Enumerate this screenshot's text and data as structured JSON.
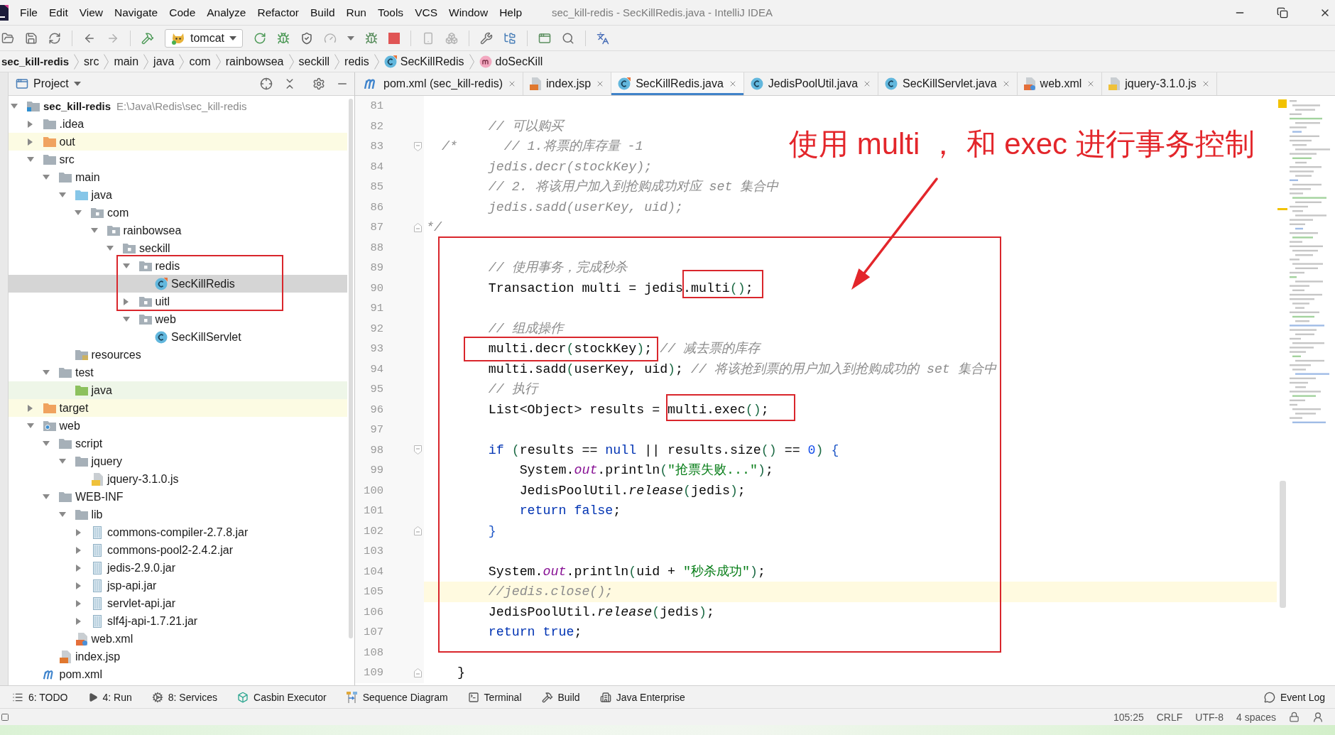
{
  "window": {
    "title": "sec_kill-redis - SecKillRedis.java - IntelliJ IDEA"
  },
  "menu": [
    "File",
    "Edit",
    "View",
    "Navigate",
    "Code",
    "Analyze",
    "Refactor",
    "Build",
    "Run",
    "Tools",
    "VCS",
    "Window",
    "Help"
  ],
  "toolbar": {
    "run_configuration": "tomcat"
  },
  "breadcrumbs": [
    {
      "label": "sec_kill-redis",
      "kind": "project"
    },
    {
      "label": "src",
      "kind": "folder"
    },
    {
      "label": "main",
      "kind": "folder"
    },
    {
      "label": "java",
      "kind": "folder"
    },
    {
      "label": "com",
      "kind": "folder"
    },
    {
      "label": "rainbowsea",
      "kind": "folder"
    },
    {
      "label": "seckill",
      "kind": "folder"
    },
    {
      "label": "redis",
      "kind": "folder"
    },
    {
      "label": "SecKillRedis",
      "kind": "class-marked"
    },
    {
      "label": "doSecKill",
      "kind": "method"
    }
  ],
  "project": {
    "title": "Project",
    "tree": [
      {
        "label": "sec_kill-redis",
        "path": "E:\\Java\\Redis\\sec_kill-redis",
        "kind": "module",
        "expanded": true,
        "selected": false,
        "children": [
          {
            "label": ".idea",
            "kind": "folder",
            "expanded": false,
            "selected": false
          },
          {
            "label": "out",
            "kind": "excluded",
            "expanded": false,
            "selected": false
          },
          {
            "label": "src",
            "kind": "folder",
            "expanded": true,
            "selected": false,
            "children": [
              {
                "label": "main",
                "kind": "folder",
                "expanded": true,
                "selected": false,
                "children": [
                  {
                    "label": "java",
                    "kind": "source-root",
                    "expanded": true,
                    "selected": false,
                    "children": [
                      {
                        "label": "com",
                        "kind": "package",
                        "expanded": true,
                        "selected": false,
                        "children": [
                          {
                            "label": "rainbowsea",
                            "kind": "package",
                            "expanded": true,
                            "selected": false,
                            "children": [
                              {
                                "label": "seckill",
                                "kind": "package",
                                "expanded": true,
                                "selected": false,
                                "children": [
                                  {
                                    "label": "redis",
                                    "kind": "package",
                                    "expanded": true,
                                    "selected": false,
                                    "children": [
                                      {
                                        "label": "SecKillRedis",
                                        "kind": "class-marked",
                                        "selected": true
                                      }
                                    ]
                                  },
                                  {
                                    "label": "uitl",
                                    "kind": "package",
                                    "expanded": false,
                                    "selected": false
                                  },
                                  {
                                    "label": "web",
                                    "kind": "package",
                                    "expanded": true,
                                    "selected": false,
                                    "children": [
                                      {
                                        "label": "SecKillServlet",
                                        "kind": "class",
                                        "selected": false
                                      }
                                    ]
                                  }
                                ]
                              }
                            ]
                          }
                        ]
                      }
                    ]
                  },
                  {
                    "label": "resources",
                    "kind": "resources-root",
                    "selected": false
                  }
                ]
              },
              {
                "label": "test",
                "kind": "folder",
                "expanded": true,
                "selected": false,
                "children": [
                  {
                    "label": "java",
                    "kind": "test-root",
                    "selected": false
                  }
                ]
              }
            ]
          },
          {
            "label": "target",
            "kind": "excluded",
            "expanded": false,
            "selected": false
          },
          {
            "label": "web",
            "kind": "web",
            "expanded": true,
            "selected": false,
            "children": [
              {
                "label": "script",
                "kind": "folder",
                "expanded": true,
                "selected": false,
                "children": [
                  {
                    "label": "jquery",
                    "kind": "folder",
                    "expanded": true,
                    "selected": false,
                    "children": [
                      {
                        "label": "jquery-3.1.0.js",
                        "kind": "js",
                        "selected": false
                      }
                    ]
                  }
                ]
              },
              {
                "label": "WEB-INF",
                "kind": "folder",
                "expanded": true,
                "selected": false,
                "children": [
                  {
                    "label": "lib",
                    "kind": "folder",
                    "expanded": true,
                    "selected": false,
                    "children": [
                      {
                        "label": "commons-compiler-2.7.8.jar",
                        "kind": "jar",
                        "expanded": false,
                        "selected": false
                      },
                      {
                        "label": "commons-pool2-2.4.2.jar",
                        "kind": "jar",
                        "expanded": false,
                        "selected": false
                      },
                      {
                        "label": "jedis-2.9.0.jar",
                        "kind": "jar",
                        "expanded": false,
                        "selected": false
                      },
                      {
                        "label": "jsp-api.jar",
                        "kind": "jar",
                        "expanded": false,
                        "selected": false
                      },
                      {
                        "label": "servlet-api.jar",
                        "kind": "jar",
                        "expanded": false,
                        "selected": false
                      },
                      {
                        "label": "slf4j-api-1.7.21.jar",
                        "kind": "jar",
                        "expanded": false,
                        "selected": false
                      }
                    ]
                  },
                  {
                    "label": "web.xml",
                    "kind": "xml",
                    "selected": false
                  }
                ]
              },
              {
                "label": "index.jsp",
                "kind": "jsp",
                "selected": false
              }
            ]
          },
          {
            "label": "pom.xml",
            "kind": "maven",
            "selected": false
          }
        ]
      }
    ]
  },
  "tabs": [
    {
      "label": "pom.xml (sec_kill-redis)",
      "kind": "maven",
      "selected": false
    },
    {
      "label": "index.jsp",
      "kind": "jsp",
      "selected": false
    },
    {
      "label": "SecKillRedis.java",
      "kind": "class-marked",
      "selected": true
    },
    {
      "label": "JedisPoolUtil.java",
      "kind": "class",
      "selected": false
    },
    {
      "label": "SecKillServlet.java",
      "kind": "class",
      "selected": false
    },
    {
      "label": "web.xml",
      "kind": "xml",
      "selected": false
    },
    {
      "label": "jquery-3.1.0.js",
      "kind": "js",
      "selected": false
    }
  ],
  "editor": {
    "lines": [
      {
        "number": "81",
        "current": false
      },
      {
        "number": "82",
        "current": false,
        "tokens": [
          {
            "kind": "comment",
            "text": "        // 可以购买"
          }
        ]
      },
      {
        "number": "83",
        "current": false,
        "fold_marker": {
          "kind": "start"
        },
        "tokens": [
          {
            "kind": "comment",
            "text": "  /*      // 1.将票的库存量 -1"
          }
        ]
      },
      {
        "number": "84",
        "current": false,
        "tokens": [
          {
            "kind": "comment",
            "text": "        jedis.decr(stockKey);"
          }
        ]
      },
      {
        "number": "85",
        "current": false,
        "tokens": [
          {
            "kind": "comment",
            "text": "        // 2. 将该用户加入到抢购成功对应 set 集合中"
          }
        ]
      },
      {
        "number": "86",
        "current": false,
        "tokens": [
          {
            "kind": "comment",
            "text": "        jedis.sadd(userKey, uid);"
          }
        ]
      },
      {
        "number": "87",
        "current": false,
        "fold_marker": {
          "kind": "end"
        },
        "tokens": [
          {
            "kind": "comment",
            "text": "*/"
          }
        ]
      },
      {
        "number": "88",
        "current": false
      },
      {
        "number": "89",
        "current": false,
        "tokens": [
          {
            "kind": "comment",
            "text": "        // 使用事务，完成秒杀"
          }
        ]
      },
      {
        "number": "90",
        "current": false,
        "tokens": [
          {
            "kind": "plain",
            "text": "        Transaction multi = jedis.multi"
          },
          {
            "kind": "paren",
            "text": "()"
          },
          {
            "kind": "plain",
            "text": ";"
          }
        ]
      },
      {
        "number": "91",
        "current": false
      },
      {
        "number": "92",
        "current": false,
        "tokens": [
          {
            "kind": "comment",
            "text": "        // 组成操作"
          }
        ]
      },
      {
        "number": "93",
        "current": false,
        "tokens": [
          {
            "kind": "plain",
            "text": "        multi.decr"
          },
          {
            "kind": "paren",
            "text": "("
          },
          {
            "kind": "plain",
            "text": "stockKey"
          },
          {
            "kind": "paren",
            "text": ")"
          },
          {
            "kind": "plain",
            "text": "; "
          },
          {
            "kind": "comment",
            "text": "// 减去票的库存"
          }
        ]
      },
      {
        "number": "94",
        "current": false,
        "tokens": [
          {
            "kind": "plain",
            "text": "        multi.sadd"
          },
          {
            "kind": "paren",
            "text": "("
          },
          {
            "kind": "plain",
            "text": "userKey, uid"
          },
          {
            "kind": "paren",
            "text": ")"
          },
          {
            "kind": "plain",
            "text": "; "
          },
          {
            "kind": "comment",
            "text": "// 将该抢到票的用户加入到抢购成功的 set 集合中"
          }
        ]
      },
      {
        "number": "95",
        "current": false,
        "tokens": [
          {
            "kind": "comment",
            "text": "        // 执行"
          }
        ]
      },
      {
        "number": "96",
        "current": false,
        "tokens": [
          {
            "kind": "plain",
            "text": "        List<Object> results = multi.exec"
          },
          {
            "kind": "paren",
            "text": "()"
          },
          {
            "kind": "plain",
            "text": ";"
          }
        ]
      },
      {
        "number": "97",
        "current": false
      },
      {
        "number": "98",
        "current": false,
        "fold_marker": {
          "kind": "start"
        },
        "tokens": [
          {
            "kind": "keyword",
            "text": "        if"
          },
          {
            "kind": "paren",
            "text": " ("
          },
          {
            "kind": "plain",
            "text": "results == "
          },
          {
            "kind": "keyword",
            "text": "null"
          },
          {
            "kind": "plain",
            "text": " || results.size"
          },
          {
            "kind": "paren",
            "text": "()"
          },
          {
            "kind": "plain",
            "text": " == "
          },
          {
            "kind": "number",
            "text": "0"
          },
          {
            "kind": "paren",
            "text": ")"
          },
          {
            "kind": "brace",
            "text": " {"
          }
        ]
      },
      {
        "number": "99",
        "current": false,
        "tokens": [
          {
            "kind": "plain",
            "text": "            System."
          },
          {
            "kind": "field",
            "text": "out"
          },
          {
            "kind": "plain",
            "text": ".println"
          },
          {
            "kind": "paren",
            "text": "("
          },
          {
            "kind": "string",
            "text": "\"抢票失败...\""
          },
          {
            "kind": "paren",
            "text": ")"
          },
          {
            "kind": "plain",
            "text": ";"
          }
        ]
      },
      {
        "number": "100",
        "current": false,
        "tokens": [
          {
            "kind": "plain",
            "text": "            JedisPoolUtil."
          },
          {
            "kind": "static",
            "text": "release"
          },
          {
            "kind": "paren",
            "text": "("
          },
          {
            "kind": "plain",
            "text": "jedis"
          },
          {
            "kind": "paren",
            "text": ")"
          },
          {
            "kind": "plain",
            "text": ";"
          }
        ]
      },
      {
        "number": "101",
        "current": false,
        "tokens": [
          {
            "kind": "keyword",
            "text": "            return false"
          },
          {
            "kind": "plain",
            "text": ";"
          }
        ]
      },
      {
        "number": "102",
        "current": false,
        "fold_marker": {
          "kind": "end"
        },
        "tokens": [
          {
            "kind": "brace",
            "text": "        }"
          }
        ]
      },
      {
        "number": "103",
        "current": false
      },
      {
        "number": "104",
        "current": false,
        "tokens": [
          {
            "kind": "plain",
            "text": "        System."
          },
          {
            "kind": "field",
            "text": "out"
          },
          {
            "kind": "plain",
            "text": ".println"
          },
          {
            "kind": "paren",
            "text": "("
          },
          {
            "kind": "plain",
            "text": "uid + "
          },
          {
            "kind": "string",
            "text": "\"秒杀成功\""
          },
          {
            "kind": "paren",
            "text": ")"
          },
          {
            "kind": "plain",
            "text": ";"
          }
        ]
      },
      {
        "number": "105",
        "current": true,
        "tokens": [
          {
            "kind": "comment",
            "text": "        //jedis.close();"
          }
        ]
      },
      {
        "number": "106",
        "current": false,
        "tokens": [
          {
            "kind": "plain",
            "text": "        JedisPoolUtil."
          },
          {
            "kind": "static",
            "text": "release"
          },
          {
            "kind": "paren",
            "text": "("
          },
          {
            "kind": "plain",
            "text": "jedis"
          },
          {
            "kind": "paren",
            "text": ")"
          },
          {
            "kind": "plain",
            "text": ";"
          }
        ]
      },
      {
        "number": "107",
        "current": false,
        "tokens": [
          {
            "kind": "keyword",
            "text": "        return true"
          },
          {
            "kind": "plain",
            "text": ";"
          }
        ]
      },
      {
        "number": "108",
        "current": false
      },
      {
        "number": "109",
        "current": false,
        "fold_marker": {
          "kind": "end"
        },
        "tokens": [
          {
            "kind": "plain",
            "text": "    }"
          }
        ]
      }
    ]
  },
  "annotation": {
    "text": "使用 multi ， 和 exec 进行事务控制"
  },
  "tool_windows": [
    {
      "label": "6: TODO",
      "kind": "todo"
    },
    {
      "label": "4: Run",
      "kind": "run"
    },
    {
      "label": "8: Services",
      "kind": "services"
    },
    {
      "label": "Casbin Executor",
      "kind": "casbin"
    },
    {
      "label": "Sequence Diagram",
      "kind": "sequence"
    },
    {
      "label": "Terminal",
      "kind": "terminal"
    },
    {
      "label": "Build",
      "kind": "build"
    },
    {
      "label": "Java Enterprise",
      "kind": "enterprise"
    }
  ],
  "event_log": {
    "label": "Event Log"
  },
  "status_bar": {
    "items": [
      "105:25",
      "CRLF",
      "UTF-8",
      "4 spaces"
    ]
  }
}
